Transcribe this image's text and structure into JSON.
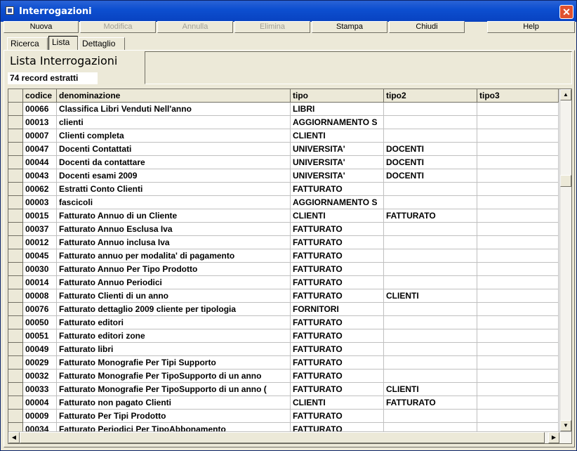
{
  "window": {
    "title": "Interrogazioni",
    "close_glyph": "✕"
  },
  "toolbar": [
    "Nuova",
    "Modifica",
    "Annulla",
    "Elimina",
    "Stampa",
    "Chiudi",
    "Help"
  ],
  "tabs": [
    "Ricerca",
    "Lista",
    "Dettaglio"
  ],
  "panel": {
    "title": "Lista Interrogazioni",
    "count": "74 record estratti"
  },
  "grid": {
    "columns": [
      "codice",
      "denominazione",
      "tipo",
      "tipo2",
      "tipo3"
    ],
    "rows": [
      [
        "00066",
        "Classifica Libri Venduti Nell'anno",
        "LIBRI",
        "",
        ""
      ],
      [
        "00013",
        "clienti",
        "AGGIORNAMENTO S",
        "",
        ""
      ],
      [
        "00007",
        "Clienti completa",
        "CLIENTI",
        "",
        ""
      ],
      [
        "00047",
        "Docenti Contattati",
        "UNIVERSITA'",
        "DOCENTI",
        ""
      ],
      [
        "00044",
        "Docenti da contattare",
        "UNIVERSITA'",
        "DOCENTI",
        ""
      ],
      [
        "00043",
        "Docenti esami 2009",
        "UNIVERSITA'",
        "DOCENTI",
        ""
      ],
      [
        "00062",
        "Estratti Conto Clienti",
        "FATTURATO",
        "",
        ""
      ],
      [
        "00003",
        "fascicoli",
        "AGGIORNAMENTO S",
        "",
        ""
      ],
      [
        "00015",
        "Fatturato Annuo di un Cliente",
        "CLIENTI",
        "FATTURATO",
        ""
      ],
      [
        "00037",
        "Fatturato Annuo Esclusa Iva",
        "FATTURATO",
        "",
        ""
      ],
      [
        "00012",
        "Fatturato Annuo inclusa Iva",
        "FATTURATO",
        "",
        ""
      ],
      [
        "00045",
        "Fatturato annuo per modalita' di pagamento",
        "FATTURATO",
        "",
        ""
      ],
      [
        "00030",
        "Fatturato Annuo Per Tipo Prodotto",
        "FATTURATO",
        "",
        ""
      ],
      [
        "00014",
        "Fatturato Annuo Periodici",
        "FATTURATO",
        "",
        ""
      ],
      [
        "00008",
        "Fatturato Clienti di un anno",
        "FATTURATO",
        "CLIENTI",
        ""
      ],
      [
        "00076",
        "Fatturato dettaglio 2009 cliente per tipologia",
        "FORNITORI",
        "",
        ""
      ],
      [
        "00050",
        "Fatturato editori",
        "FATTURATO",
        "",
        ""
      ],
      [
        "00051",
        "Fatturato editori zone",
        "FATTURATO",
        "",
        ""
      ],
      [
        "00049",
        "Fatturato libri",
        "FATTURATO",
        "",
        ""
      ],
      [
        "00029",
        "Fatturato Monografie Per Tipi Supporto",
        "FATTURATO",
        "",
        ""
      ],
      [
        "00032",
        "Fatturato Monografie Per TipoSupporto di un anno",
        "FATTURATO",
        "",
        ""
      ],
      [
        "00033",
        "Fatturato Monografie Per TipoSupporto di un anno (",
        "FATTURATO",
        "CLIENTI",
        ""
      ],
      [
        "00004",
        "Fatturato non pagato Clienti",
        "CLIENTI",
        "FATTURATO",
        ""
      ],
      [
        "00009",
        "Fatturato Per Tipi Prodotto",
        "FATTURATO",
        "",
        ""
      ],
      [
        "00034",
        "Fatturato Periodici Per TipoAbbonamento",
        "FATTURATO",
        "",
        ""
      ]
    ]
  },
  "scroll": {
    "up": "▲",
    "down": "▼",
    "left": "◀",
    "right": "▶"
  }
}
